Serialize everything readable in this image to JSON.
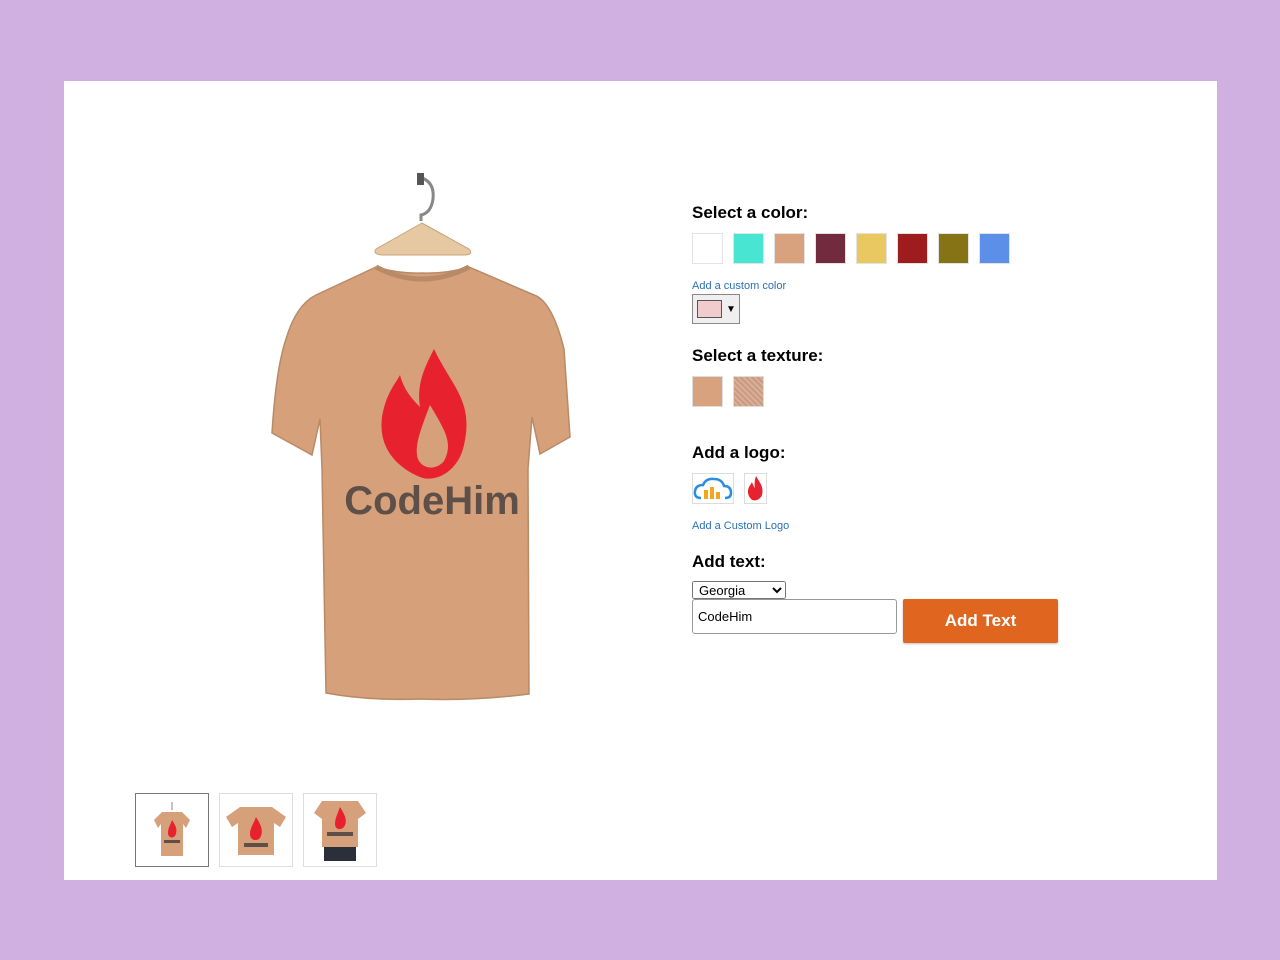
{
  "colors": {
    "page_bg": "#cfb0e0",
    "card_bg": "#ffffff",
    "shirt": "#d5a07a",
    "accent": "#e0651f",
    "link": "#2a6fb8",
    "custom_color": "#f0cccc"
  },
  "preview": {
    "logo_text": "CodeHim",
    "logo_icon": "flame-icon"
  },
  "thumbnails": [
    {
      "name": "hanger-view",
      "active": true
    },
    {
      "name": "flat-view",
      "active": false
    },
    {
      "name": "model-view",
      "active": false
    }
  ],
  "color_section": {
    "label": "Select a color:",
    "swatches": [
      "#ffffff",
      "#48e5d2",
      "#d9a27e",
      "#722a3e",
      "#eac861",
      "#9e1b1e",
      "#867316",
      "#5b8fe8"
    ],
    "custom_link": "Add a custom color"
  },
  "texture_section": {
    "label": "Select a texture:",
    "textures": [
      "plain-texture",
      "heather-texture"
    ]
  },
  "logo_section": {
    "label": "Add a logo:",
    "logos": [
      "cloud-bars-logo",
      "flame-logo"
    ],
    "custom_link": "Add a Custom Logo"
  },
  "text_section": {
    "label": "Add text:",
    "font_selected": "Georgia",
    "text_value": "CodeHim",
    "button_label": "Add Text"
  }
}
